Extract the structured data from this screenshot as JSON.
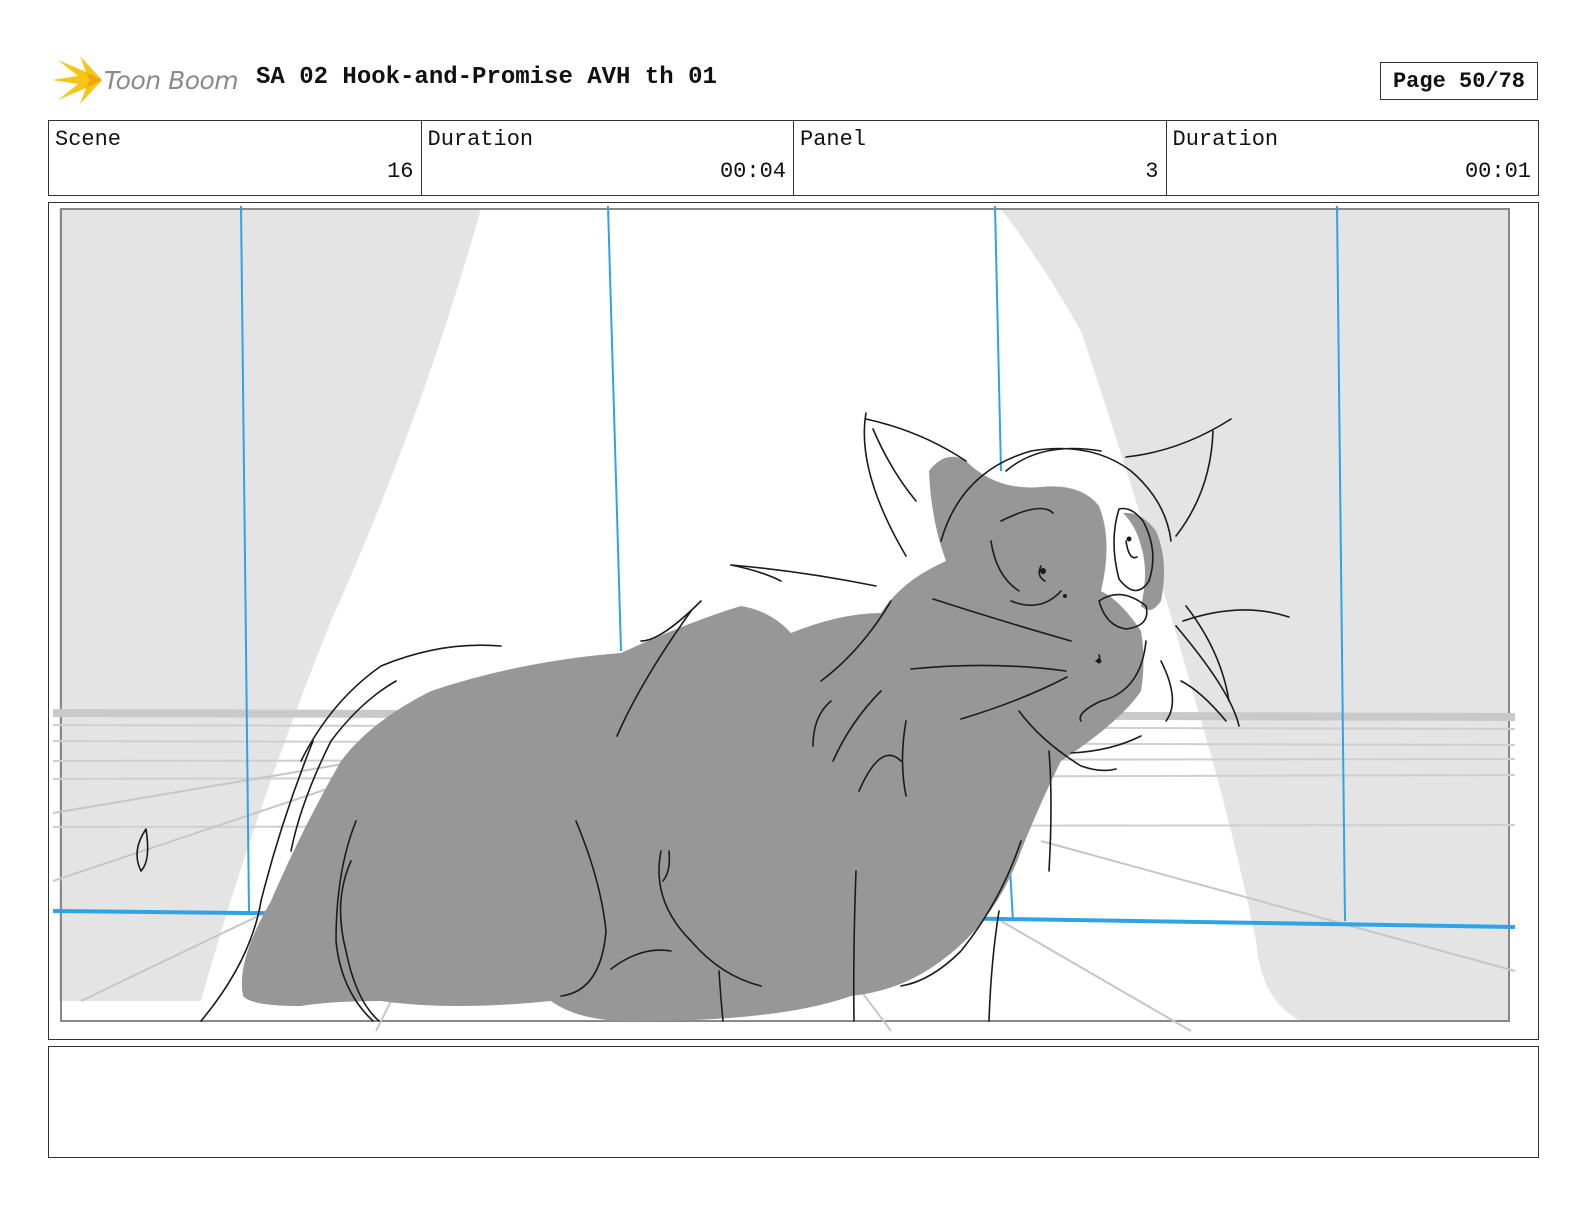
{
  "header": {
    "logo_text": "Toon Boom",
    "title": "SA 02 Hook-and-Promise AVH th 01",
    "page_label": "Page 50/78"
  },
  "info": {
    "scene_label": "Scene",
    "scene_value": "16",
    "scene_duration_label": "Duration",
    "scene_duration_value": "00:04",
    "panel_label": "Panel",
    "panel_value": "3",
    "panel_duration_label": "Duration",
    "panel_duration_value": "00:01"
  },
  "notes": {
    "text": ""
  },
  "colors": {
    "guide_blue": "#2ea3e6",
    "fill_gray": "#979797",
    "curtain_gray": "#e4e4e4",
    "logo_yellow": "#f5c518"
  }
}
